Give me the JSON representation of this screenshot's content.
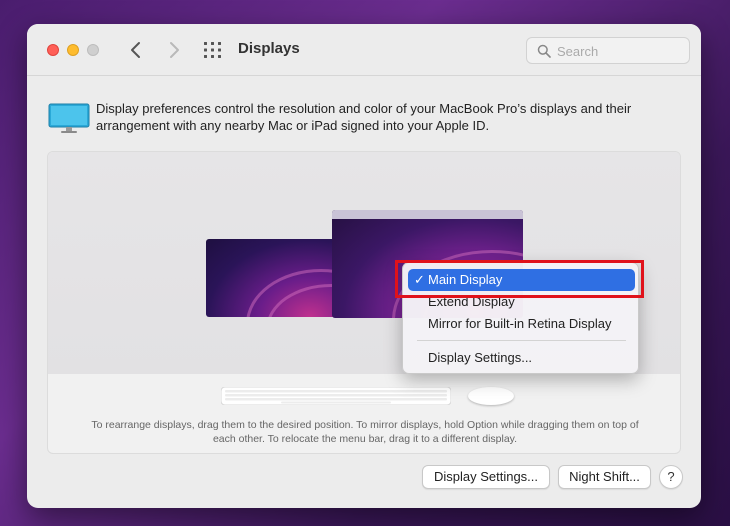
{
  "window": {
    "title": "Displays"
  },
  "search": {
    "placeholder": "Search"
  },
  "info": {
    "text": "Display preferences control the resolution and color of your MacBook Pro’s displays and their arrangement with any nearby Mac or iPad signed into your Apple ID."
  },
  "arrangement": {
    "hint": "To rearrange displays, drag them to the desired position. To mirror displays, hold Option while dragging them on top of each other. To relocate the menu bar, drag it to a different display."
  },
  "context_menu": {
    "check": "✓",
    "items": [
      {
        "label": "Main Display",
        "checked": true,
        "highlighted": true
      },
      {
        "label": "Extend Display",
        "checked": false
      },
      {
        "label": "Mirror for Built-in Retina Display",
        "checked": false
      },
      {
        "label": "Display Settings...",
        "checked": false
      }
    ]
  },
  "buttons": {
    "display_settings": "Display Settings...",
    "night_shift": "Night Shift...",
    "help": "?"
  },
  "colors": {
    "menu_highlight": "#2f6fe3",
    "annotation_box": "#e0121b",
    "close": "#ff5f57",
    "minimize": "#febc2e"
  },
  "icons": {
    "back": "chevron-left-icon",
    "forward": "chevron-right-icon",
    "grid": "grid-icon",
    "search": "magnifier-icon",
    "display": "display-icon",
    "check": "checkmark-icon"
  }
}
